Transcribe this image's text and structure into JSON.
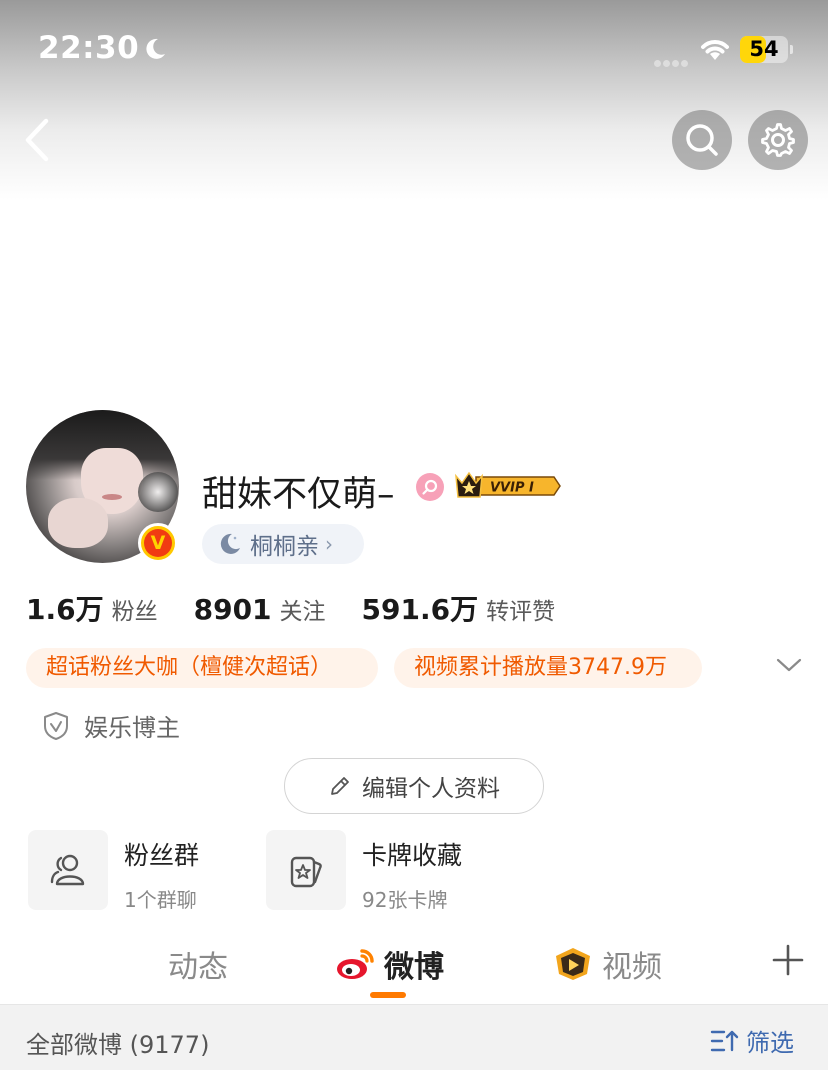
{
  "status_bar": {
    "time": "22:30",
    "battery": "54",
    "battery_level": 0.54
  },
  "nav": {
    "back_icon": "chevron-left-icon",
    "search_icon": "search-icon",
    "settings_icon": "gear-icon"
  },
  "profile": {
    "username": "甜妹不仅萌–",
    "vvip_label": "VVIP I",
    "title_chip": "桐桐亲",
    "verified_badge": "V"
  },
  "stats": [
    {
      "value": "1.6万",
      "label": "粉丝"
    },
    {
      "value": "8901",
      "label": "关注"
    },
    {
      "value": "591.6万",
      "label": "转评赞"
    }
  ],
  "tags": [
    "超话粉丝大咖（檀健次超话）",
    "视频累计播放量3747.9万"
  ],
  "role": "娱乐博主",
  "edit_button": "编辑个人资料",
  "features": [
    {
      "title": "粉丝群",
      "subtitle": "1个群聊",
      "icon": "group-icon"
    },
    {
      "title": "卡牌收藏",
      "subtitle": "92张卡牌",
      "icon": "card-icon"
    }
  ],
  "tabs": [
    {
      "label": "动态"
    },
    {
      "label": "微博",
      "icon": "weibo-icon",
      "active": true
    },
    {
      "label": "视频",
      "icon": "video-play-icon"
    }
  ],
  "filter_bar": {
    "title": "全部微博 (9177)",
    "filter_label": "筛选"
  },
  "colors": {
    "accent_orange": "#ff7a00",
    "tag_text": "#f05a00",
    "tag_bg": "#fff3ea",
    "link_blue": "#3f6ab0",
    "battery_yellow": "#ffd60a"
  }
}
